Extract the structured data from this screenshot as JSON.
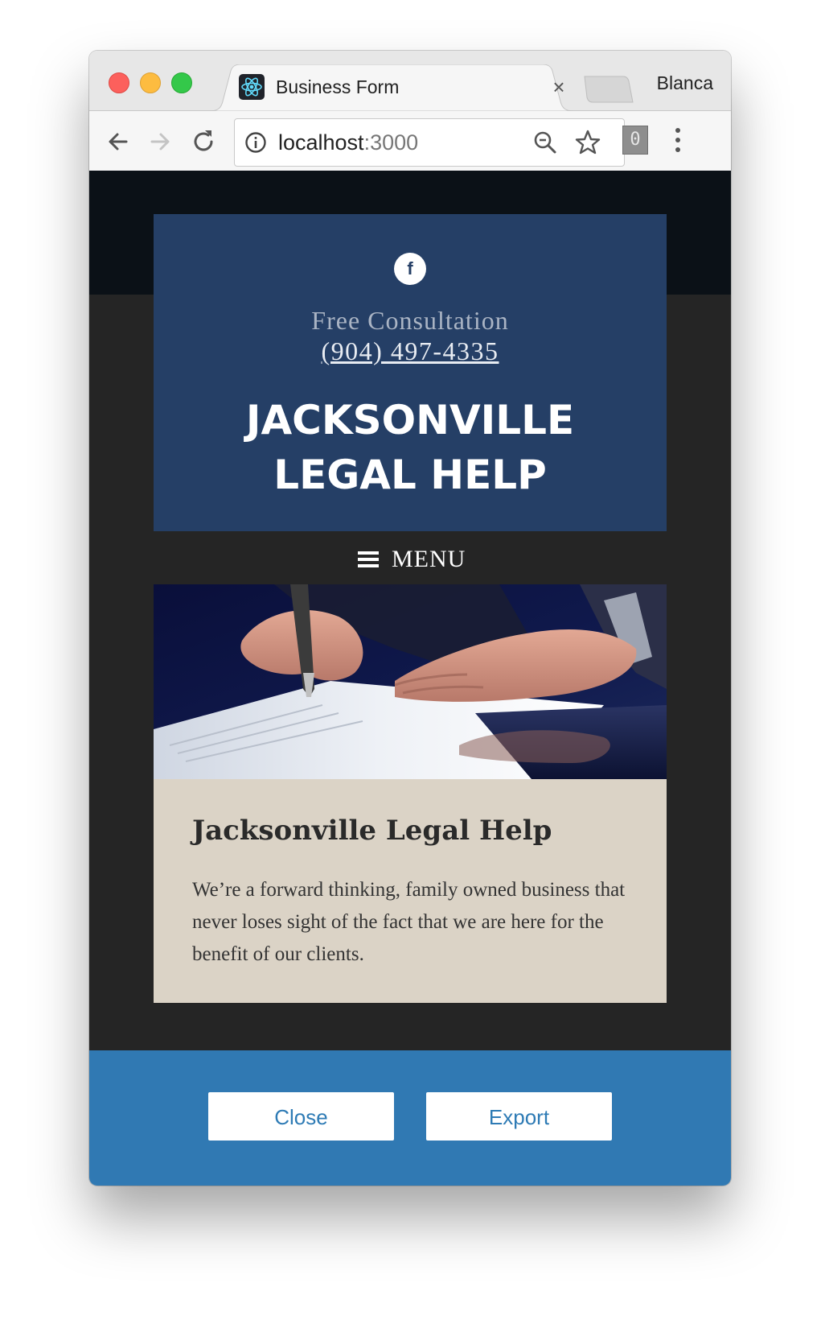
{
  "browser": {
    "tab_title": "Business Form",
    "tab_favicon": "react-icon",
    "profile_name": "Blanca",
    "url_host": "localhost",
    "url_port": ":3000",
    "extension_badge": "0"
  },
  "site": {
    "social_icon_label": "f",
    "consultation_text": "Free Consultation",
    "phone": "(904) 497-4335",
    "title_line1": "JACKSONVILLE",
    "title_line2": "LEGAL HELP",
    "menu_label": "MENU"
  },
  "content": {
    "heading": "Jacksonville Legal Help",
    "body": "We’re a forward thinking, family owned business that never loses sight of the fact that we are here for the benefit of our clients."
  },
  "footer": {
    "close_label": "Close",
    "export_label": "Export"
  },
  "colors": {
    "header_blue": "#253f66",
    "page_dark": "#252525",
    "card_beige": "#dbd3c6",
    "footer_blue": "#3079b3"
  }
}
